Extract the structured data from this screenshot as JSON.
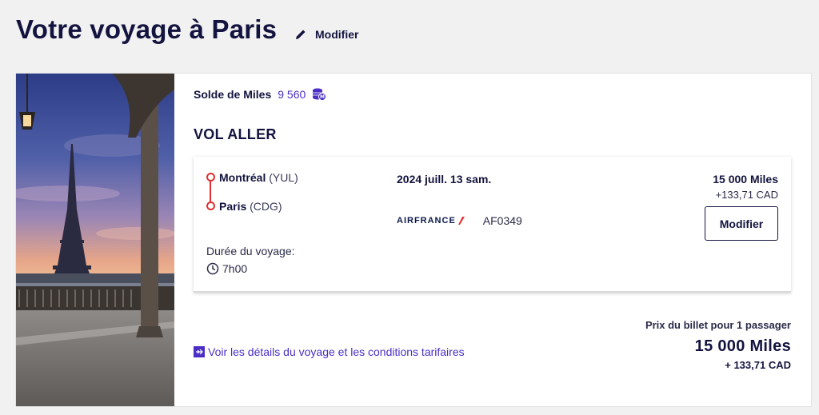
{
  "header": {
    "title": "Votre voyage à Paris",
    "modify_label": "Modifier"
  },
  "balance": {
    "label": "Solde de Miles",
    "value": "9 560"
  },
  "leg": {
    "title": "VOL ALLER",
    "origin_city": "Montréal",
    "origin_code": "(YUL)",
    "destination_city": "Paris",
    "destination_code": "(CDG)",
    "duration_label": "Durée du voyage:",
    "duration": "7h00",
    "date": "2024 juill. 13 sam.",
    "airline_name": "AIRFRANCE",
    "flight_number": "AF0349",
    "price_miles": "15 000  Miles",
    "price_tax": "+133,71 CAD",
    "modify_label": "Modifier"
  },
  "footer": {
    "details_link": "Voir les détails du voyage et les conditions tarifaires",
    "total_label": "Prix du billet pour 1 passager",
    "total_miles": "15 000  Miles",
    "total_tax": "+ 133,71 CAD"
  },
  "colors": {
    "navy": "#13133f",
    "accent_purple": "#4a2ec5",
    "route_red": "#e03030"
  },
  "icons": {
    "header_modify": "pencil-icon",
    "balance": "miles-coin-icon",
    "duration": "clock-icon",
    "details": "plane-icon"
  }
}
